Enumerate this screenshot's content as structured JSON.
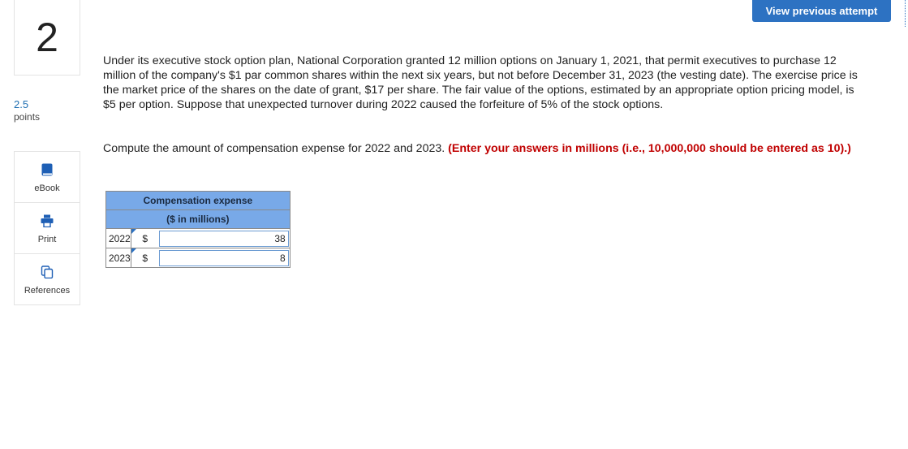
{
  "question": {
    "number": "2",
    "points_value": "2.5",
    "points_label": "points",
    "body": "Under its executive stock option plan, National Corporation granted 12 million options on January 1, 2021, that permit executives to purchase 12 million of the company's $1 par common shares within the next six years, but not before December 31, 2023 (the vesting date). The exercise price is the market price of the shares on the date of grant, $17 per share. The fair value of the options, estimated by an appropriate option pricing model, is $5 per option. Suppose that unexpected turnover during 2022 caused the forfeiture of 5% of the stock options.",
    "instruction": "Compute the amount of compensation expense for 2022 and 2023.",
    "instruction_note": "(Enter your answers in millions (i.e., 10,000,000 should be entered as 10).)"
  },
  "header": {
    "view_previous_label": "View previous attempt"
  },
  "tools": [
    {
      "label": "eBook",
      "icon": "book-icon"
    },
    {
      "label": "Print",
      "icon": "printer-icon"
    },
    {
      "label": "References",
      "icon": "references-icon"
    }
  ],
  "table": {
    "header_line1": "Compensation expense",
    "header_line2": "($ in millions)",
    "rows": [
      {
        "year": "2022",
        "currency": "$",
        "value": "38"
      },
      {
        "year": "2023",
        "currency": "$",
        "value": "8"
      }
    ]
  },
  "colors": {
    "accent": "#2d72c2",
    "table_header": "#78a9e8",
    "note_red": "#c00000"
  }
}
